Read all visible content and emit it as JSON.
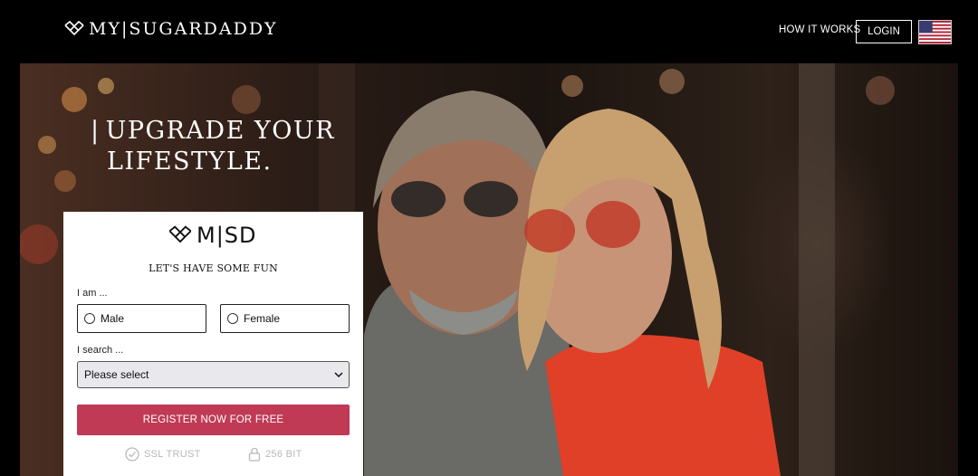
{
  "header": {
    "logo_text": "MY|SUGARDADDY",
    "nav_how_it_works": "HOW IT WORKS",
    "login_label": "LOGIN",
    "language_flag": "us-flag-icon"
  },
  "hero": {
    "headline_bar": "|",
    "headline_line1": "UPGRADE YOUR",
    "headline_line2": "LIFESTYLE."
  },
  "form": {
    "logo_text": "M|SD",
    "tagline": "LET'S HAVE SOME FUN",
    "i_am_label": "I am ...",
    "gender_options": [
      "Male",
      "Female"
    ],
    "i_search_label": "I search ...",
    "search_select_value": "Please select",
    "register_label": "REGISTER NOW FOR FREE",
    "trust_ssl": "SSL TRUST",
    "trust_bit": "256 BIT"
  },
  "colors": {
    "accent": "#c03a55",
    "header_bg": "#000000",
    "card_bg": "#ffffff"
  }
}
